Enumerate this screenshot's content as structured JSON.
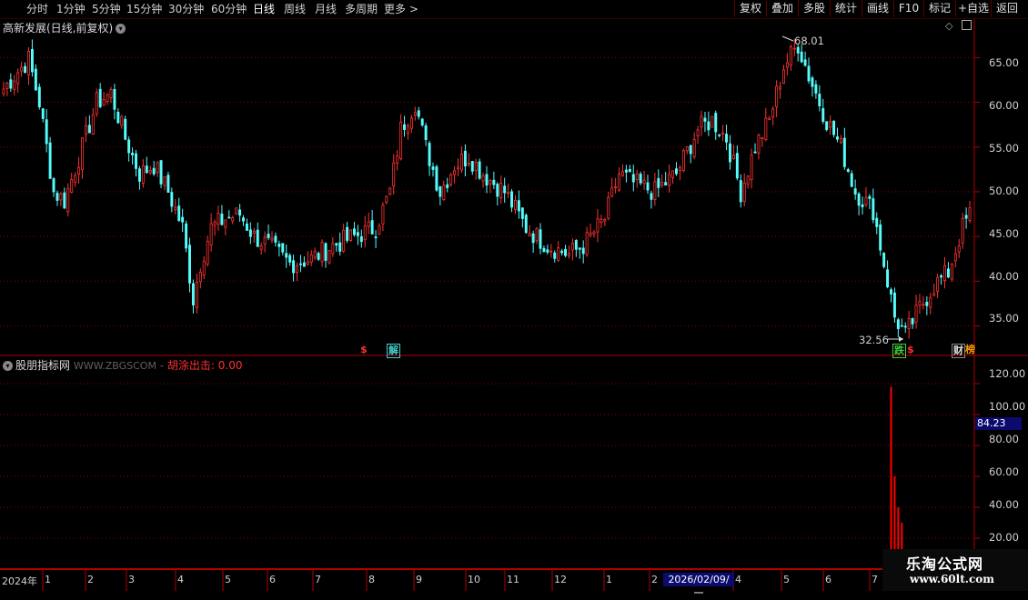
{
  "toolbar": {
    "periods": [
      "分时",
      "1分钟",
      "5分钟",
      "15分钟",
      "30分钟",
      "60分钟",
      "日线",
      "周线",
      "月线",
      "多周期",
      "更多"
    ],
    "more_arrow": ">",
    "buttons": [
      "复权",
      "叠加",
      "多股",
      "统计",
      "画线",
      "F10",
      "标记",
      "+自选",
      "返回"
    ]
  },
  "main_chart": {
    "title": "高新发展(日线,前复权)",
    "y_ticks": [
      "65.00",
      "60.00",
      "55.00",
      "50.00",
      "45.00",
      "40.00",
      "35.00"
    ],
    "high_label": "68.01",
    "low_label": "32.56",
    "markers": [
      {
        "text": "$",
        "color": "#ff3030"
      },
      {
        "text": "解",
        "color": "#40d0d0"
      },
      {
        "text": "跌",
        "color": "#40d040"
      },
      {
        "text": "$",
        "color": "#ff3030"
      },
      {
        "text": "财",
        "color": "#e0e0e0"
      },
      {
        "text": "榜",
        "color": "#ff9900"
      }
    ]
  },
  "indicator": {
    "name": "股朋指标网",
    "site": "WWW.ZBGSCOM",
    "separator": " - ",
    "line_label": "胡涂出击:",
    "line_value": "0.00",
    "y_ticks": [
      "120.00",
      "100.00",
      "84.23",
      "80.00",
      "60.00",
      "40.00",
      "20.00"
    ],
    "current_tag": "84.23"
  },
  "time_axis": {
    "labels": [
      "2024年",
      "1",
      "2",
      "3",
      "4",
      "5",
      "6",
      "7",
      "8",
      "9",
      "10",
      "11",
      "12",
      "1",
      "2",
      "4",
      "5",
      "6",
      "7"
    ],
    "current_date": "2026/02/09/一"
  },
  "watermark": {
    "title": "乐淘公式网",
    "url": "www.60lt.com"
  },
  "colors": {
    "up": "#ff3232",
    "down": "#54fcfc",
    "grid": "#8b0000",
    "frame": "#b00000",
    "signal": "#ff0000"
  },
  "chart_data": {
    "type": "candlestick",
    "ylim": [
      32.0,
      69.0
    ],
    "anchors_price": [
      [
        0,
        61.5
      ],
      [
        3,
        63
      ],
      [
        7,
        64.8
      ],
      [
        10,
        60
      ],
      [
        14,
        50
      ],
      [
        17,
        49
      ],
      [
        22,
        55
      ],
      [
        26,
        60
      ],
      [
        30,
        61
      ],
      [
        34,
        56
      ],
      [
        38,
        52
      ],
      [
        42,
        53
      ],
      [
        46,
        50
      ],
      [
        50,
        46
      ],
      [
        53,
        38
      ],
      [
        55,
        42
      ],
      [
        58,
        46
      ],
      [
        62,
        47
      ],
      [
        66,
        47.5
      ],
      [
        70,
        45
      ],
      [
        74,
        44
      ],
      [
        80,
        42
      ],
      [
        86,
        42.5
      ],
      [
        92,
        44
      ],
      [
        98,
        45
      ],
      [
        104,
        46
      ],
      [
        108,
        50
      ],
      [
        111,
        57
      ],
      [
        115,
        60
      ],
      [
        118,
        55
      ],
      [
        122,
        50
      ],
      [
        126,
        53
      ],
      [
        130,
        54
      ],
      [
        134,
        52
      ],
      [
        140,
        50
      ],
      [
        146,
        46
      ],
      [
        152,
        44
      ],
      [
        158,
        43
      ],
      [
        162,
        44
      ],
      [
        168,
        47
      ],
      [
        172,
        52
      ],
      [
        176,
        51
      ],
      [
        182,
        50
      ],
      [
        188,
        52
      ],
      [
        194,
        57
      ],
      [
        198,
        58
      ],
      [
        202,
        56
      ],
      [
        206,
        50
      ],
      [
        210,
        55
      ],
      [
        214,
        58
      ],
      [
        218,
        64
      ],
      [
        222,
        66.5
      ],
      [
        225,
        63
      ],
      [
        230,
        58
      ],
      [
        234,
        55
      ],
      [
        238,
        50
      ],
      [
        243,
        48
      ],
      [
        246,
        42
      ],
      [
        249,
        36
      ],
      [
        252,
        34
      ],
      [
        256,
        37
      ],
      [
        260,
        39.5
      ],
      [
        264,
        41
      ],
      [
        268,
        46
      ],
      [
        270,
        47.5
      ]
    ],
    "indicator_ylim": [
      0,
      130
    ],
    "signal_spikes": [
      118,
      60,
      40,
      30
    ],
    "signal_spike_bars": [
      248,
      249,
      250,
      251
    ]
  }
}
